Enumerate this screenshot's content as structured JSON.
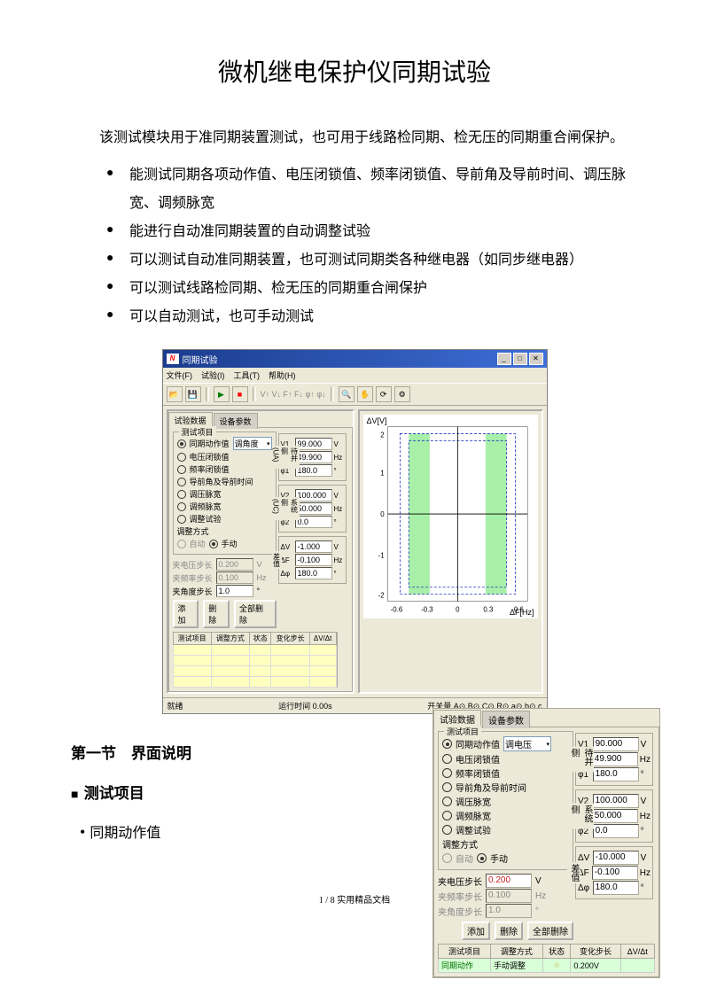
{
  "doc": {
    "title": "微机继电保护仪同期试验",
    "intro": "该测试模块用于准同期装置测试，也可用于线路检同期、检无压的同期重合闸保护。",
    "bullets": [
      "能测试同期各项动作值、电压闭锁值、频率闭锁值、导前角及导前时间、调压脉宽、调频脉宽",
      "能进行自动准同期装置的自动调整试验",
      "可以测试自动准同期装置，也可测试同期类各种继电器（如同步继电器）",
      "可以测试线路检同期、检无压的同期重合闸保护",
      "可以自动测试，也可手动测试"
    ],
    "section1": "第一节　界面说明",
    "test_items_heading": "测试项目",
    "sync_action_heading": "同期动作值",
    "page_footer": "1 / 8 实用精品文档"
  },
  "app": {
    "menus": [
      "文件(F)",
      "试验(I)",
      "工具(T)",
      "帮助(H)"
    ],
    "window_title": "同期试验",
    "tabs": {
      "tab1": "试验数据",
      "tab2": "设备参数"
    },
    "test_items_group": "测试项目",
    "radios": {
      "sync_action": "同期动作值",
      "volt_lock": "电压闭锁值",
      "freq_lock": "频率闭锁值",
      "lead": "导前角及导前时间",
      "v_pulse": "调压脉宽",
      "f_pulse": "调频脉宽",
      "adjust_test": "调整试验"
    },
    "adjust_mode_label": "调整方式",
    "mode_auto": "自动",
    "mode_manual": "手动",
    "steps": {
      "v_step_label": "夹电压步长",
      "v_step_val": "0.200",
      "v_step_unit": "V",
      "f_step_label": "夹频率步长",
      "f_step_val": "0.100",
      "f_step_unit": "Hz",
      "a_step_label": "夹角度步长",
      "a_step_val": "1.0",
      "a_step_unit": "°"
    },
    "btn_add": "添加",
    "btn_del": "删除",
    "btn_clear": "全部删除",
    "dropdowns": {
      "dd1": "调角度",
      "dd2": "调电压"
    },
    "table_headers": [
      "测试项目",
      "调整方式",
      "状态",
      "变化步长",
      "ΔV/Δt"
    ],
    "status_ready": "就绪",
    "status_runtime": "运行时间 0.00s",
    "status_io": "开关量 A⊙ B⊙ C⊙ R⊙ a⊙ b⊙ c",
    "groups": {
      "pending_side": "待并侧",
      "pending_side_sub": "(UA)",
      "system_side": "系统侧",
      "system_side_sub": "(UC)",
      "delta": "差值"
    },
    "params": {
      "V1_l": "V1",
      "V1_v": "99.000",
      "V1_u": "V",
      "F1_l": "F1",
      "F1_v": "49.900",
      "F1_u": "Hz",
      "P1_l": "φ1",
      "P1_v": "180.0",
      "P1_u": "°",
      "V2_l": "V2",
      "V2_v": "100.000",
      "V2_u": "V",
      "F2_l": "F2",
      "F2_v": "50.000",
      "F2_u": "Hz",
      "P2_l": "φ2",
      "P2_v": "0.0",
      "P2_u": "°",
      "dV_l": "ΔV",
      "dV_v": "-1.000",
      "dV_u": "V",
      "dF_l": "ΔF",
      "dF_v": "-0.100",
      "dF_u": "Hz",
      "dP_l": "Δφ",
      "dP_v": "180.0",
      "dP_u": "°"
    },
    "chart": {
      "ytitle": "ΔV[V]",
      "xtitle": "ΔF[Hz]",
      "yticks": [
        "2",
        "1",
        "0",
        "-1",
        "-2"
      ],
      "xticks": [
        "-0.6",
        "-0.3",
        "0",
        "0.3",
        "0.6"
      ]
    }
  },
  "shot2": {
    "params": {
      "V1_v": "90.000",
      "dV_v": "-10.000"
    },
    "table_row": {
      "c1": "同期动作",
      "c2": "手动调整",
      "c3": "☆",
      "c4": "0.200V"
    }
  }
}
